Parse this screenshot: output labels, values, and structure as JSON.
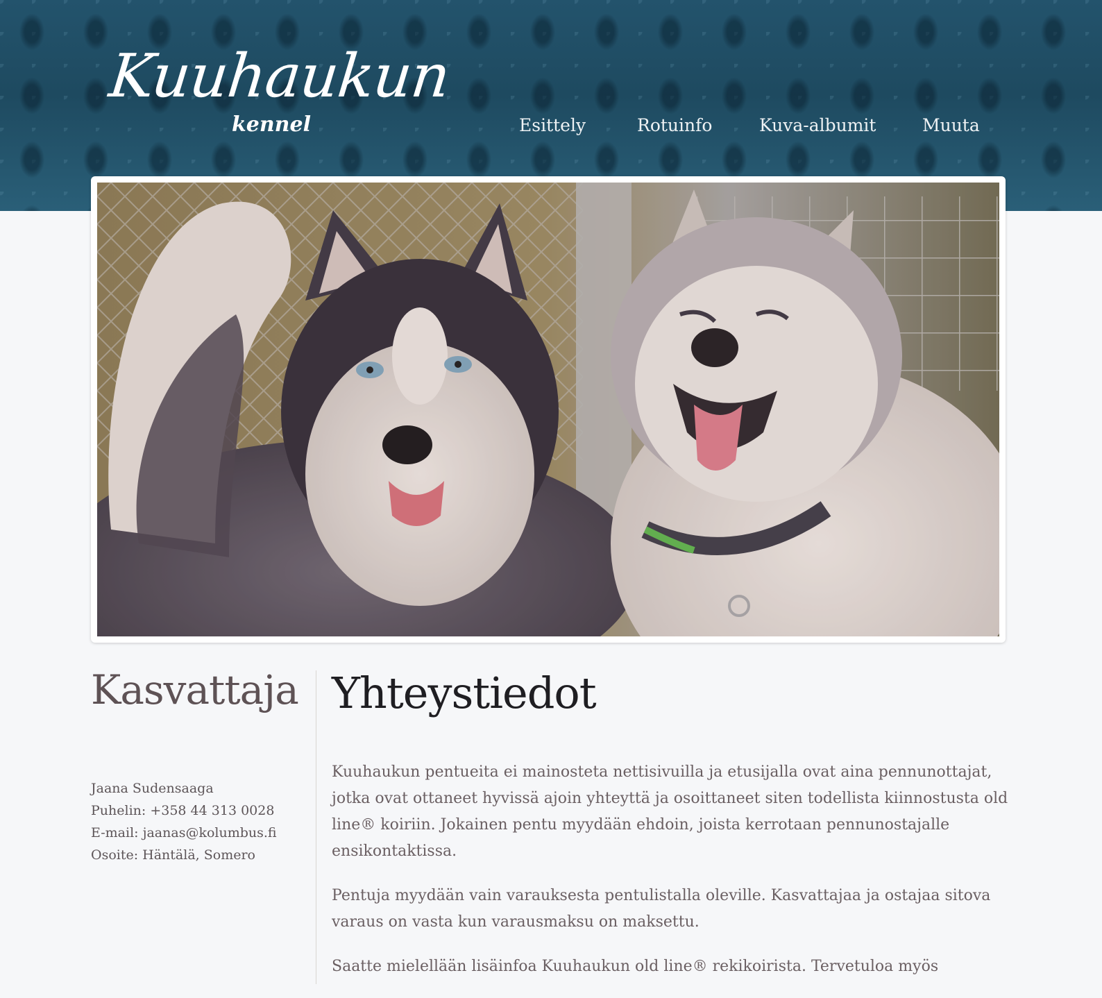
{
  "header": {
    "logo": {
      "main": "Kuuhaukun",
      "sub": "kennel"
    },
    "nav": [
      {
        "label": "Esittely"
      },
      {
        "label": "Rotuinfo"
      },
      {
        "label": "Kuva-albumit"
      },
      {
        "label": "Muuta"
      }
    ]
  },
  "hero": {
    "subject": "two husky dogs in front of a fence"
  },
  "sidebar": {
    "title": "Kasvattaja",
    "contact": [
      "Jaana Sudensaaga",
      "Puhelin: +358 44 313 0028",
      "E-mail: jaanas@kolumbus.fi",
      "Osoite: Häntälä, Somero"
    ]
  },
  "main": {
    "title": "Yhteystiedot",
    "paragraphs": [
      "Kuuhaukun pentueita ei mainosteta nettisivuilla ja etusijalla ovat aina pennunottajat, jotka ovat ottaneet hyvissä ajoin yhteyttä ja osoittaneet siten todellista kiinnostusta old line® koiriin. Jokainen pentu myydään ehdoin, joista kerrotaan pennunostajalle ensikontaktissa.",
      "Pentuja myydään vain varauksesta pentulistalla oleville. Kasvattajaa ja ostajaa sitova varaus on vasta kun varausmaksu on maksettu.",
      "Saatte mielellään lisäinfoa Kuuhaukun old line® rekikoirista. Tervetuloa myös"
    ]
  },
  "colors": {
    "header_bg": "#1f4f66",
    "page_bg": "#f6f7f9",
    "title_dark": "#1f1e22",
    "sidebar_title": "#5e5255",
    "body_text": "#6a5f62"
  }
}
